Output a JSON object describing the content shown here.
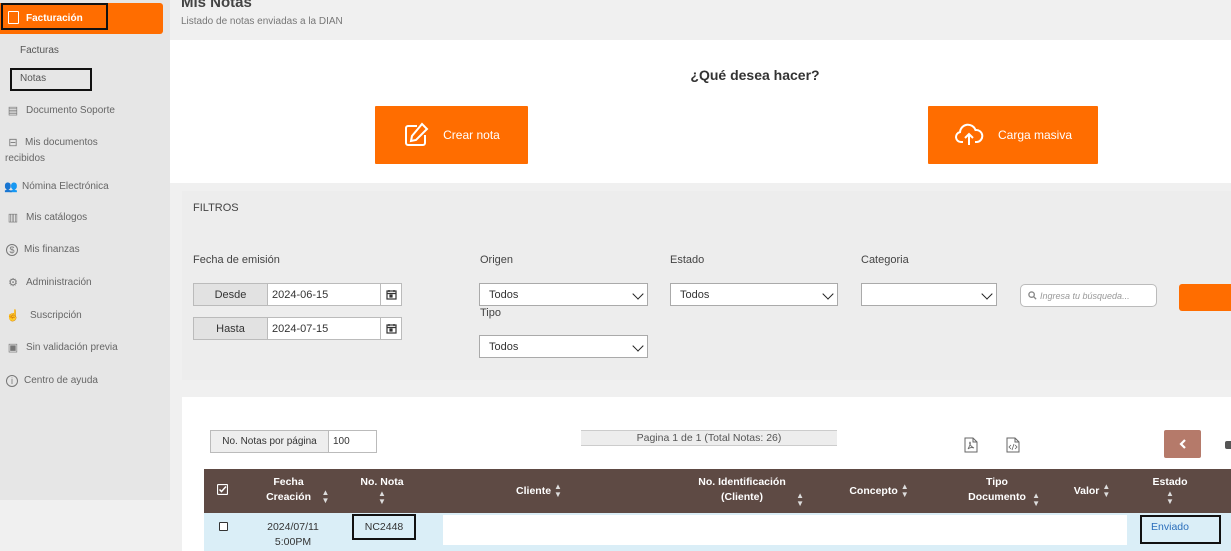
{
  "sidebar": {
    "active": "Facturación",
    "sub_items": [
      "Facturas",
      "Notas"
    ],
    "items": [
      {
        "label": "Documento Soporte",
        "icon": "document-icon"
      },
      {
        "label": "Mis documentos recibidos",
        "icon": "inbox-icon"
      },
      {
        "label": "Nómina Electrónica",
        "icon": "users-icon"
      },
      {
        "label": "Mis catálogos",
        "icon": "map-icon"
      },
      {
        "label": "Mis finanzas",
        "icon": "dollar-icon"
      },
      {
        "label": "Administración",
        "icon": "cogs-icon"
      },
      {
        "label": "Suscripción",
        "icon": "hand-icon"
      },
      {
        "label": "Sin validación previa",
        "icon": "search-doc-icon"
      },
      {
        "label": "Centro de ayuda",
        "icon": "info-icon"
      }
    ]
  },
  "header": {
    "title": "Mis Notas",
    "subtitle": "Listado de notas enviadas a la DIAN"
  },
  "actions": {
    "question": "¿Qué desea hacer?",
    "create_label": "Crear nota",
    "bulk_label": "Carga masiva"
  },
  "filters": {
    "title": "FILTROS",
    "date_label": "Fecha de emisión",
    "from_label": "Desde",
    "from_value": "2024-06-15",
    "to_label": "Hasta",
    "to_value": "2024-07-15",
    "origin_label": "Origen",
    "origin_value": "Todos",
    "type_label": "Tipo",
    "type_value": "Todos",
    "state_label": "Estado",
    "state_value": "Todos",
    "category_label": "Categoria",
    "category_value": "",
    "search_placeholder": "Ingresa tu búsqueda..."
  },
  "table": {
    "per_page_label": "No. Notas por página",
    "per_page_value": "100",
    "page_info": "Pagina 1 de 1 (Total Notas: 26)",
    "headers": {
      "fecha": "Fecha Creación",
      "no_nota": "No. Nota",
      "cliente": "Cliente",
      "no_id": "No. Identificación (Cliente)",
      "concepto": "Concepto",
      "tipo_doc": "Tipo Documento",
      "valor": "Valor",
      "estado": "Estado"
    },
    "rows": [
      {
        "fecha_line1": "2024/07/11",
        "fecha_line2": "5:00PM",
        "no_nota": "NC2448",
        "estado": "Enviado"
      }
    ]
  },
  "colors": {
    "accent": "#ff6d00",
    "table_header": "#5e4a44",
    "row_highlight": "#daeef7",
    "status_link": "#2a6ebb"
  }
}
